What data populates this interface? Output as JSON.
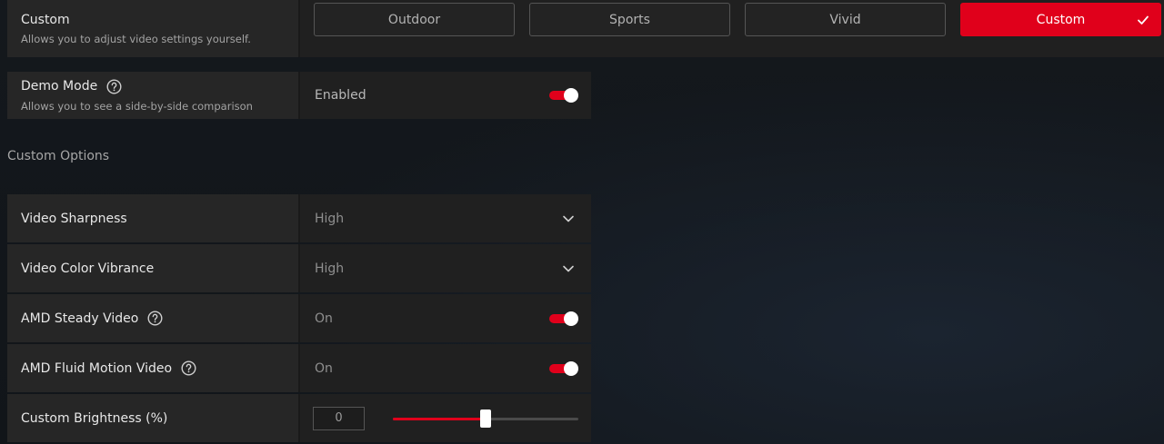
{
  "preset": {
    "title": "Custom",
    "subtitle": "Allows you to adjust video settings yourself.",
    "options": [
      {
        "label": "Outdoor",
        "active": false
      },
      {
        "label": "Sports",
        "active": false
      },
      {
        "label": "Vivid",
        "active": false
      },
      {
        "label": "Custom",
        "active": true
      }
    ]
  },
  "demo_mode": {
    "title": "Demo Mode",
    "subtitle": "Allows you to see a side-by-side comparison",
    "value": "Enabled",
    "toggle_on": true
  },
  "custom_options": {
    "section_title": "Custom Options",
    "video_sharpness": {
      "label": "Video Sharpness",
      "value": "High"
    },
    "video_color_vibrance": {
      "label": "Video Color Vibrance",
      "value": "High"
    },
    "amd_steady_video": {
      "label": "AMD Steady Video",
      "value": "On",
      "toggle_on": true
    },
    "amd_fluid_motion_video": {
      "label": "AMD Fluid Motion Video",
      "value": "On",
      "toggle_on": true
    },
    "custom_brightness": {
      "label": "Custom Brightness (%)",
      "value": "0",
      "min": -100,
      "max": 100,
      "slider_value": 0
    }
  },
  "colors": {
    "accent": "#e0001b",
    "panel": "#262626",
    "panel_value": "#202020",
    "background": "#12161b"
  },
  "icons": {
    "help": "question-circle-icon",
    "check": "checkmark-icon",
    "dropdown": "chevron-down-icon"
  }
}
